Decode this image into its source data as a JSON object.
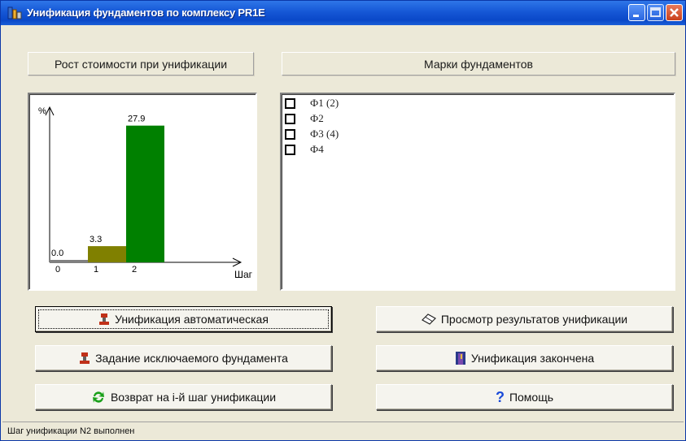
{
  "window": {
    "title": "Унификация фундаментов по комплексу PR1E"
  },
  "panels": {
    "cost_growth_label": "Рост стоимости при унификации",
    "marks_label": "Марки фундаментов"
  },
  "chart_data": {
    "type": "bar",
    "ylabel": "%",
    "xlabel": "Шаг",
    "x": [
      "0",
      "1",
      "2"
    ],
    "values": [
      0.0,
      3.3,
      27.9
    ],
    "data_labels": [
      "0.0",
      "3.3",
      "27.9"
    ],
    "colors": [
      "#808080",
      "#808000",
      "#008000"
    ],
    "ylim": [
      0,
      30
    ]
  },
  "marks": [
    {
      "label": "Ф1 (2)",
      "checked": false
    },
    {
      "label": "Ф2",
      "checked": false
    },
    {
      "label": "Ф3 (4)",
      "checked": false
    },
    {
      "label": "Ф4",
      "checked": false
    }
  ],
  "buttons": {
    "auto": "Унификация автоматическая",
    "exclude": "Задание исключаемого фундамента",
    "back": "Возврат на  i-й шаг унификации",
    "view": "Просмотр результатов унификации",
    "done": "Унификация закончена",
    "help": "Помощь"
  },
  "status": {
    "text": "Шаг унификации N2 выполнен"
  }
}
